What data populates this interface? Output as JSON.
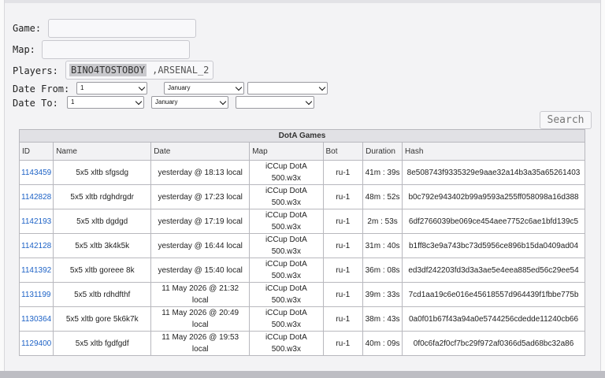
{
  "form": {
    "game_label": "Game:",
    "game_value": "",
    "map_label": "Map:",
    "map_value": "",
    "players_label": "Players:",
    "players_chip": "BINO4TOSTOBOY",
    "players_rest": " ,ARSENAL_2",
    "date_from_label": "Date From:",
    "date_to_label": "Date To:",
    "date_from": {
      "day": "1",
      "month": "January",
      "year": ""
    },
    "date_to": {
      "day": "1",
      "month": "January",
      "year": ""
    },
    "search_label": "Search"
  },
  "table": {
    "caption": "DotA Games",
    "headers": [
      "ID",
      "Name",
      "Date",
      "Map",
      "Bot",
      "Duration",
      "Hash"
    ],
    "rows": [
      {
        "id": "1143459",
        "name": "5x5 xltb sfgsdg",
        "date": "yesterday @ 18:13 local",
        "map": "iCCup DotA 500.w3x",
        "bot": "ru-1",
        "duration": "41m : 39s",
        "hash": "8e508743f9335329e9aae32a14b3a35a65261403"
      },
      {
        "id": "1142828",
        "name": "5x5 xltb rdghdrgdr",
        "date": "yesterday @ 17:23 local",
        "map": "iCCup DotA 500.w3x",
        "bot": "ru-1",
        "duration": "48m : 52s",
        "hash": "b0c792e943402b99a9593a255ff058098a16d388"
      },
      {
        "id": "1142193",
        "name": "5x5 xltb dgdgd",
        "date": "yesterday @ 17:19 local",
        "map": "iCCup DotA 500.w3x",
        "bot": "ru-1",
        "duration": "2m : 53s",
        "hash": "6df2766039be069ce454aee7752c6ae1bfd139c5"
      },
      {
        "id": "1142128",
        "name": "5x5 xltb 3k4k5k",
        "date": "yesterday @ 16:44 local",
        "map": "iCCup DotA 500.w3x",
        "bot": "ru-1",
        "duration": "31m : 40s",
        "hash": "b1ff8c3e9a743bc73d5956ce896b15da0409ad04"
      },
      {
        "id": "1141392",
        "name": "5x5 xltb goreee 8k",
        "date": "yesterday @ 15:40 local",
        "map": "iCCup DotA 500.w3x",
        "bot": "ru-1",
        "duration": "36m : 08s",
        "hash": "ed3df242203fd3d3a3ae5e4eea885ed56c29ee54"
      },
      {
        "id": "1131199",
        "name": "5x5 xltb rdhdfthf",
        "date": "11 May 2026 @ 21:32 local",
        "map": "iCCup DotA 500.w3x",
        "bot": "ru-1",
        "duration": "39m : 33s",
        "hash": "7cd1aa19c6e016e45618557d964439f1fbbe775b"
      },
      {
        "id": "1130364",
        "name": "5x5 xltb gore 5k6k7k",
        "date": "11 May 2026 @ 20:49 local",
        "map": "iCCup DotA 500.w3x",
        "bot": "ru-1",
        "duration": "38m : 43s",
        "hash": "0a0f01b67f43a94a0e5744256cdedde11240cb66"
      },
      {
        "id": "1129400",
        "name": "5x5 xltb fgdfgdf",
        "date": "11 May 2026 @ 19:53 local",
        "map": "iCCup DotA 500.w3x",
        "bot": "ru-1",
        "duration": "40m : 09s",
        "hash": "0f0c6fa2f0cf7bc29f972af0366d5ad68bc32a86"
      }
    ]
  }
}
